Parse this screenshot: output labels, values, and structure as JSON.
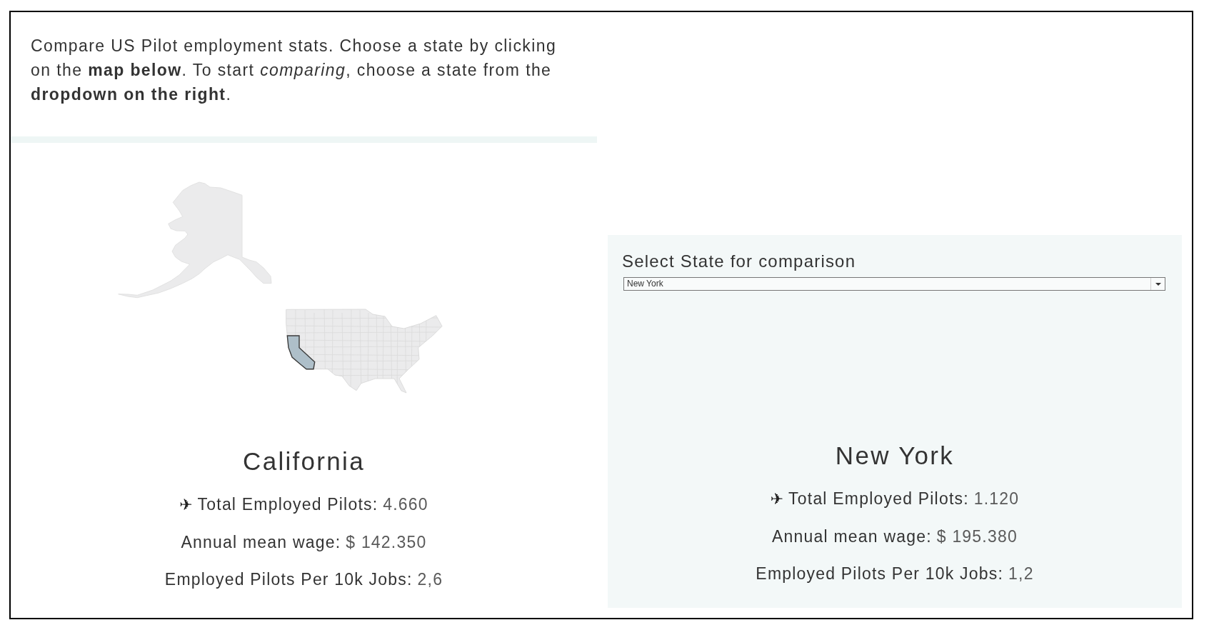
{
  "intro": "Compare US Pilot employment stats. Choose a state by clicking on the **map below**. To start *comparing*, choose a state from the **dropdown on the right**.",
  "primary": {
    "title": "California",
    "stats": [
      {
        "icon": "✈",
        "label": "Total Employed Pilots:",
        "value": "4.660"
      },
      {
        "label": "Annual mean wage:",
        "value": "$ 142.350"
      },
      {
        "label": "Employed Pilots Per 10k Jobs:",
        "value": "2,6"
      }
    ]
  },
  "comparison": {
    "heading": "Select State for comparison",
    "dropdown": {
      "value": "New York"
    },
    "title": "New York",
    "stats": [
      {
        "icon": "✈",
        "label": "Total Employed Pilots:",
        "value": "1.120"
      },
      {
        "label": "Annual mean wage:",
        "value": "$ 195.380"
      },
      {
        "label": "Employed Pilots Per 10k Jobs:",
        "value": "1,2"
      }
    ]
  }
}
